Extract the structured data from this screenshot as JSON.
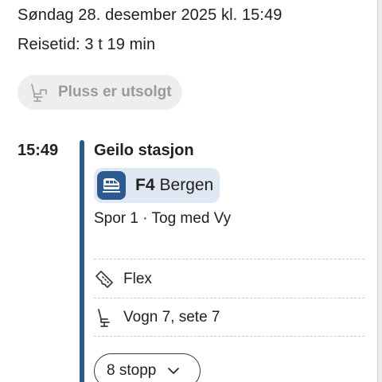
{
  "trip": {
    "date_text": "Søndag 28. desember 2025 kl. 15:49",
    "duration_text": "Reisetid: 3 t 19 min",
    "pluss_status": "Pluss er utsolgt"
  },
  "departure": {
    "time": "15:49",
    "station": "Geilo stasjon",
    "line_code": "F4",
    "destination": "Bergen",
    "platform_info": "Spor 1 · Tog med Vy",
    "fare": "Flex",
    "seat": "Vogn 7, sete 7",
    "stops_label": "8 stopp"
  },
  "icons": {
    "pluss": "seat-icon",
    "train": "train-icon",
    "fare": "ticket-icon",
    "seat": "seat-icon",
    "expand": "chevron-down-icon"
  },
  "colors": {
    "line_accent": "#2c5a8f",
    "line_chip_bg": "#dfe8f3",
    "disabled_chip_bg": "#eeeeee",
    "disabled_text": "#9a9a9a",
    "text": "#212121"
  }
}
